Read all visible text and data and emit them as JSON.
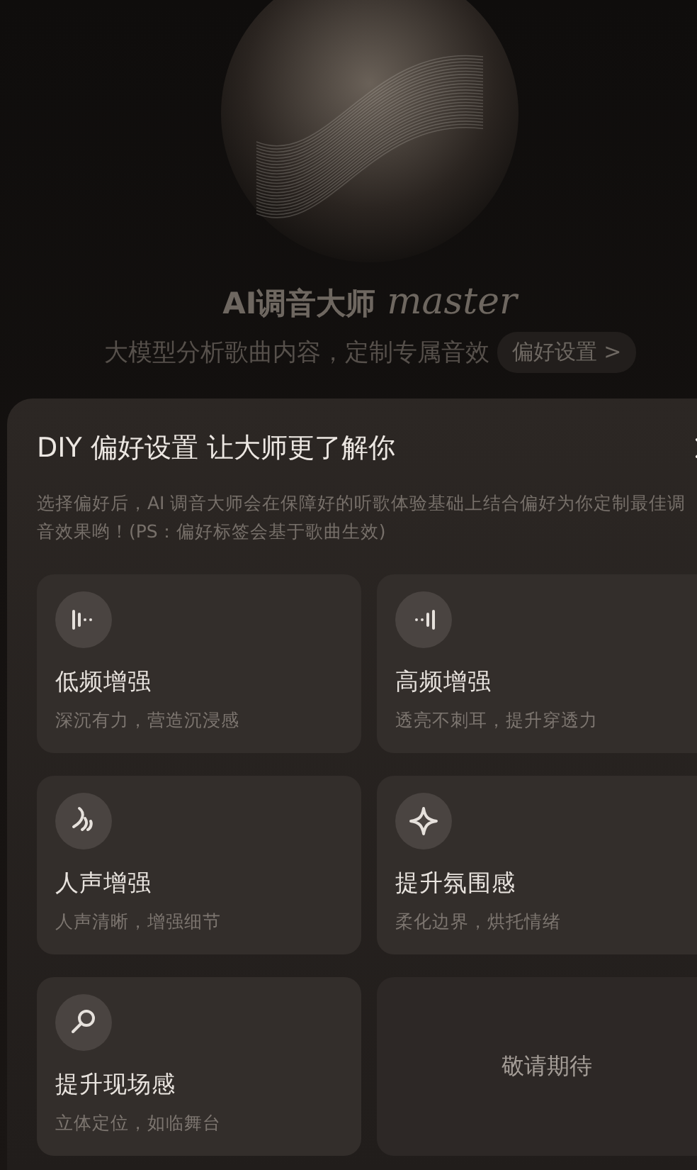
{
  "hero": {
    "title": "AI调音大师",
    "title_script": "master",
    "subtitle": "大模型分析歌曲内容，定制专属音效",
    "preference_button": "偏好设置 >"
  },
  "sheet": {
    "title": "DIY 偏好设置 让大师更了解你",
    "description": "选择偏好后，AI 调音大师会在保障好的听歌体验基础上结合偏好为你定制最佳调音效果哟！(PS：偏好标签会基于歌曲生效)",
    "options": [
      {
        "kind": "feature",
        "title": "低频增强",
        "caption": "深沉有力，营造沉浸感"
      },
      {
        "kind": "feature",
        "title": "高频增强",
        "caption": "透亮不刺耳，提升穿透力"
      },
      {
        "kind": "feature",
        "title": "人声增强",
        "caption": "人声清晰，增强细节"
      },
      {
        "kind": "feature",
        "title": "提升氛围感",
        "caption": "柔化边界，烘托情绪"
      },
      {
        "kind": "feature",
        "title": "提升现场感",
        "caption": "立体定位，如临舞台"
      },
      {
        "kind": "placeholder",
        "title": "敬请期待"
      }
    ]
  }
}
